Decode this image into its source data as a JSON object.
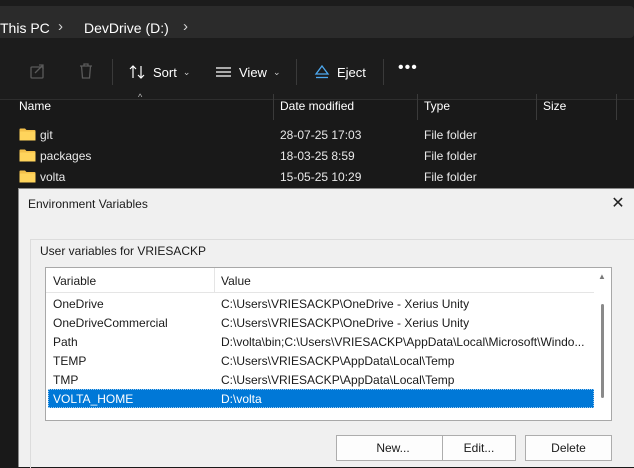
{
  "explorer": {
    "breadcrumb": [
      "This PC",
      "DevDrive (D:)"
    ],
    "toolbar": {
      "sort_label": "Sort",
      "view_label": "View",
      "eject_label": "Eject"
    },
    "columns": {
      "name": "Name",
      "date_modified": "Date modified",
      "type": "Type",
      "size": "Size"
    },
    "files": [
      {
        "name": "git",
        "date": "28-07-25 17:03",
        "type": "File folder"
      },
      {
        "name": "packages",
        "date": "18-03-25 8:59",
        "type": "File folder"
      },
      {
        "name": "volta",
        "date": "15-05-25 10:29",
        "type": "File folder"
      }
    ],
    "colors": {
      "folder": "#f3c04a",
      "background": "#191919"
    }
  },
  "dialog": {
    "title": "Environment Variables",
    "group_label": "User variables for VRIESACKP",
    "columns": {
      "variable": "Variable",
      "value": "Value"
    },
    "rows": [
      {
        "variable": "OneDrive",
        "value": "C:\\Users\\VRIESACKP\\OneDrive - Xerius Unity"
      },
      {
        "variable": "OneDriveCommercial",
        "value": "C:\\Users\\VRIESACKP\\OneDrive - Xerius Unity"
      },
      {
        "variable": "Path",
        "value": "D:\\volta\\bin;C:\\Users\\VRIESACKP\\AppData\\Local\\Microsoft\\Windo..."
      },
      {
        "variable": "TEMP",
        "value": "C:\\Users\\VRIESACKP\\AppData\\Local\\Temp"
      },
      {
        "variable": "TMP",
        "value": "C:\\Users\\VRIESACKP\\AppData\\Local\\Temp"
      },
      {
        "variable": "VOLTA_HOME",
        "value": "D:\\volta",
        "selected": true
      }
    ],
    "buttons": {
      "new": "New...",
      "edit": "Edit...",
      "delete": "Delete"
    },
    "colors": {
      "selection": "#0078d7"
    }
  }
}
